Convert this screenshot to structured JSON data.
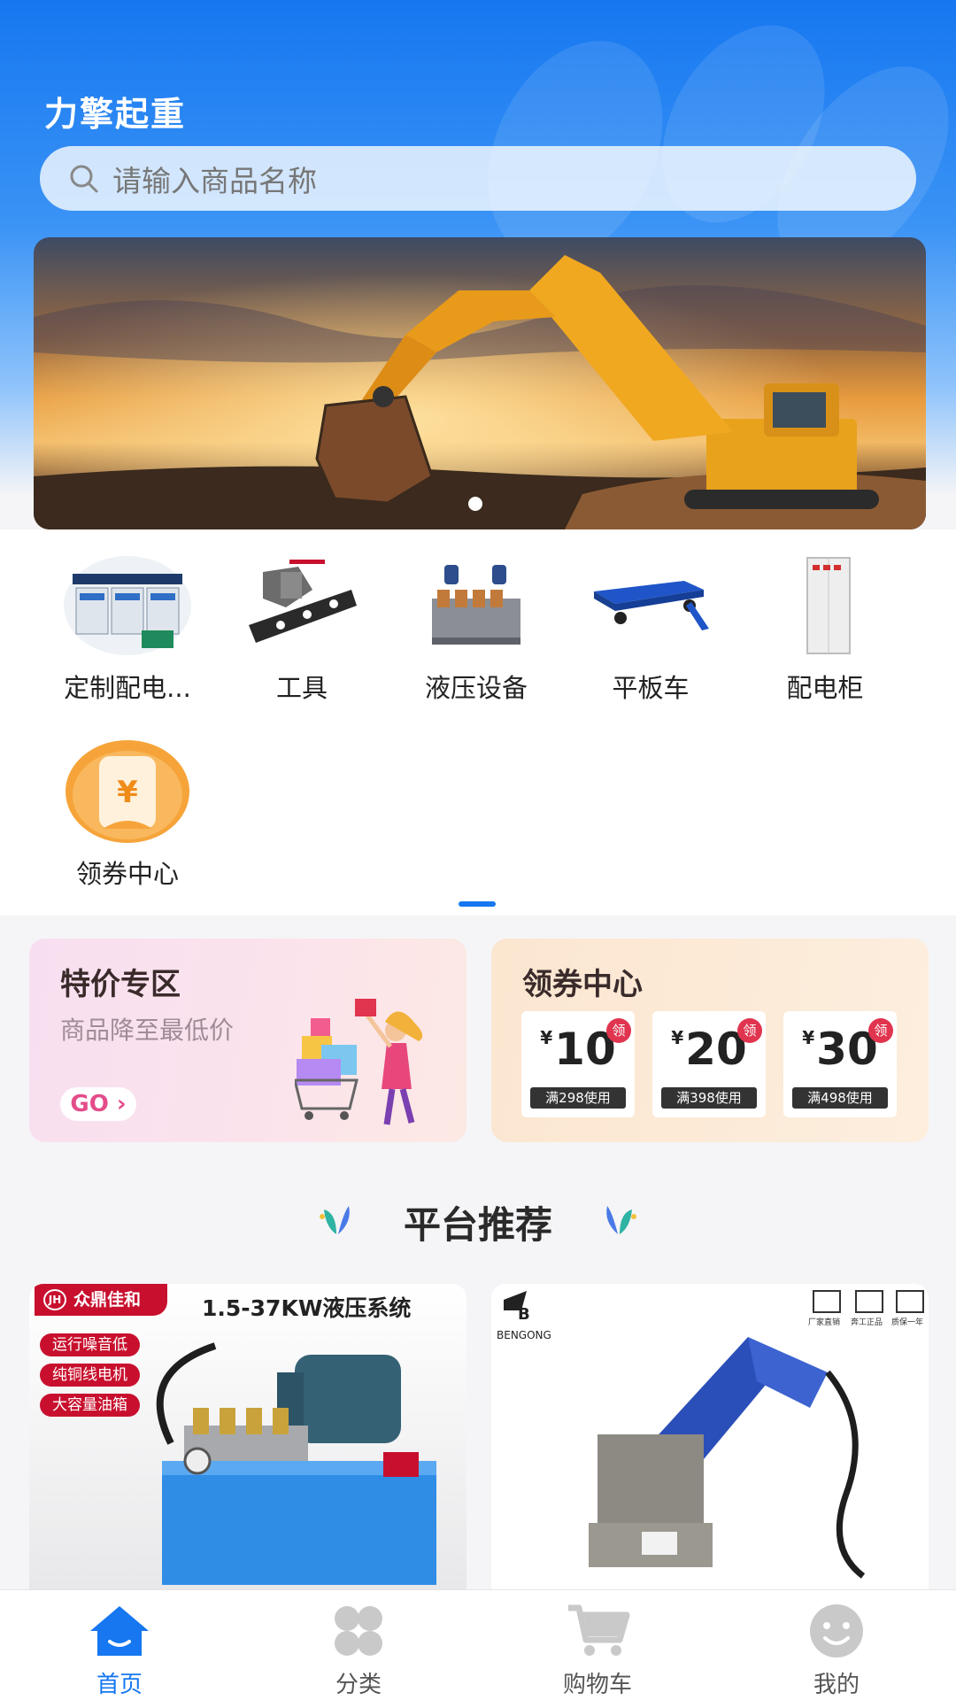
{
  "app": {
    "title": "力擎起重"
  },
  "search": {
    "placeholder": "请输入商品名称"
  },
  "categories": [
    {
      "label": "定制配电...",
      "icon": "switchboard-image"
    },
    {
      "label": "工具",
      "icon": "punching-tool-image"
    },
    {
      "label": "液压设备",
      "icon": "hydraulic-valve-image"
    },
    {
      "label": "平板车",
      "icon": "flatbed-cart-image"
    },
    {
      "label": "配电柜",
      "icon": "distribution-cabinet-image"
    },
    {
      "label": "领券中心",
      "icon": "coupon-icon"
    }
  ],
  "promo": {
    "special": {
      "title": "特价专区",
      "subtitle": "商品降至最低价",
      "button": "GO"
    },
    "coupons": {
      "title": "领券中心",
      "items": [
        {
          "currency": "¥",
          "amount": "10",
          "condition": "满298使用",
          "badge": "领"
        },
        {
          "currency": "¥",
          "amount": "20",
          "condition": "满398使用",
          "badge": "领"
        },
        {
          "currency": "¥",
          "amount": "30",
          "condition": "满498使用",
          "badge": "领"
        }
      ]
    }
  },
  "section": {
    "title": "平台推荐"
  },
  "products": [
    {
      "brand": "众鼎佳和",
      "headline": "1.5-37KW液压系统",
      "tags": [
        "运行噪音低",
        "纯铜线电机",
        "大容量油箱"
      ]
    },
    {
      "brand": "BENGONG",
      "badges": [
        "厂家直销",
        "奔工正品",
        "质保一年"
      ]
    }
  ],
  "tabbar": {
    "items": [
      {
        "label": "首页",
        "icon": "home-icon",
        "active": true
      },
      {
        "label": "分类",
        "icon": "category-icon",
        "active": false
      },
      {
        "label": "购物车",
        "icon": "cart-icon",
        "active": false
      },
      {
        "label": "我的",
        "icon": "profile-icon",
        "active": false
      }
    ]
  },
  "colors": {
    "primary": "#1677f0",
    "badge_red": "#e0344f",
    "brand_red": "#c8102e"
  }
}
